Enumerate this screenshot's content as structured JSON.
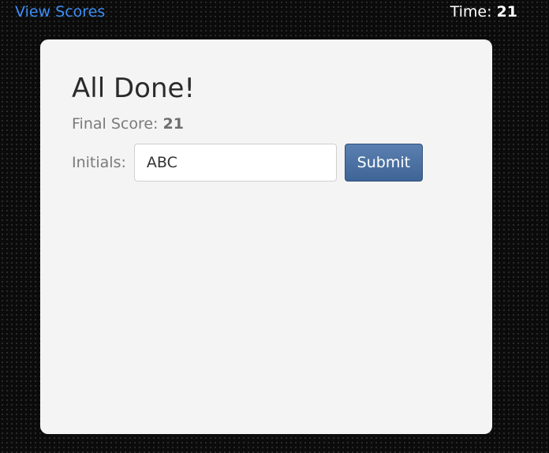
{
  "header": {
    "view_scores_label": "View Scores",
    "time_label": "Time:",
    "time_value": "21"
  },
  "card": {
    "title": "All Done!",
    "final_score_label": "Final Score:",
    "final_score_value": "21",
    "initials_label": "Initials:",
    "initials_value": "ABC",
    "submit_label": "Submit"
  },
  "colors": {
    "link": "#3d8ef5",
    "card_background": "#f4f4f4",
    "submit_button": "#4a6fa3"
  }
}
